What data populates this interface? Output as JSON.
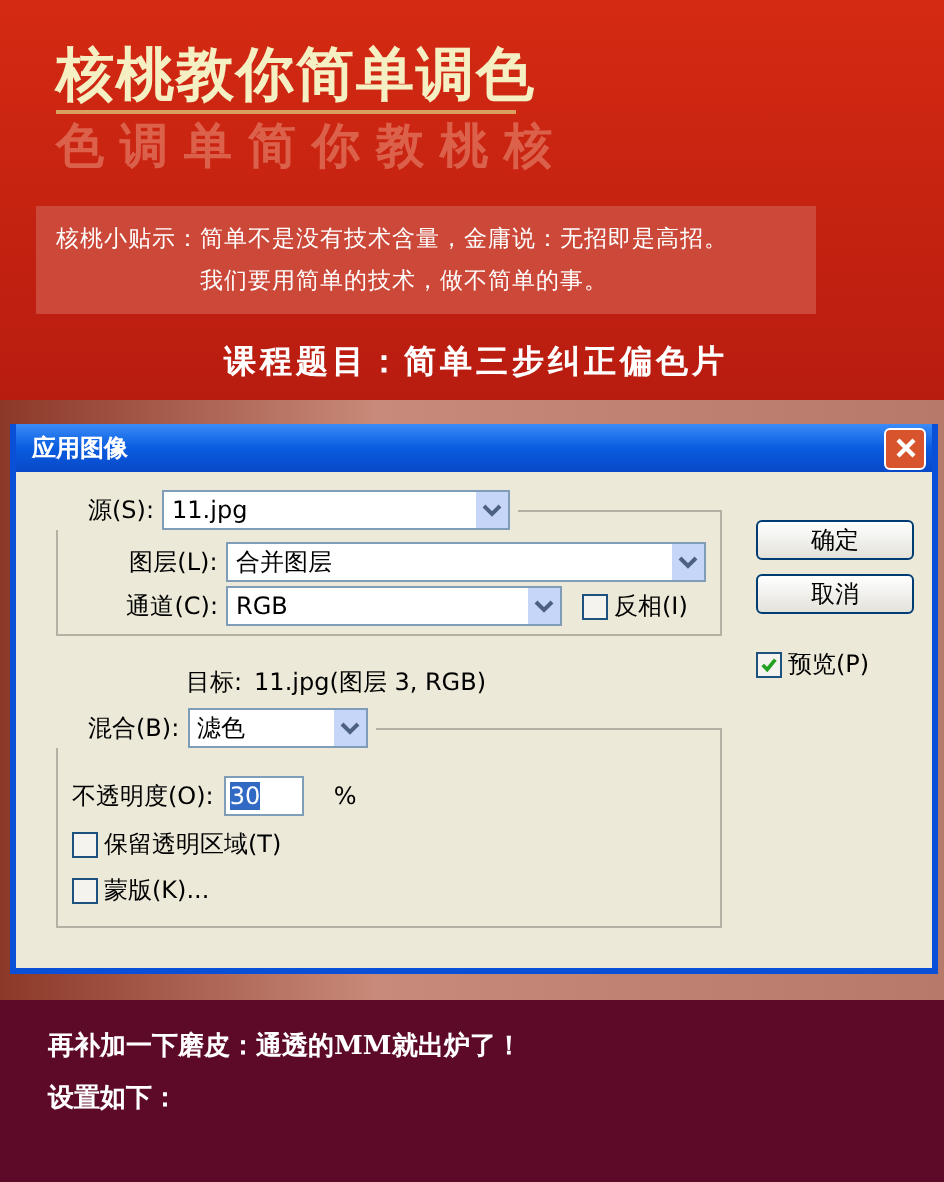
{
  "header": {
    "title": "核桃教你简单调色",
    "title_reflection": "色调单简你教桃核",
    "tip_label": "核桃小贴示：",
    "tip_lines": [
      "简单不是没有技术含量，金庸说：无招即是高招。",
      "我们要用简单的技术，做不简单的事。"
    ],
    "course": "课程题目：简单三步纠正偏色片"
  },
  "dialog": {
    "title": "应用图像",
    "source": {
      "label": "源(S):",
      "value": "11.jpg"
    },
    "layer": {
      "label": "图层(L):",
      "value": "合并图层"
    },
    "channel": {
      "label": "通道(C):",
      "value": "RGB"
    },
    "invert": {
      "label": "反相(I)",
      "checked": false
    },
    "buttons": [
      "确定",
      "取消"
    ],
    "preview": {
      "label": "预览(P)",
      "checked": true
    },
    "target": {
      "label": "目标:",
      "value": "11.jpg(图层 3, RGB)"
    },
    "blending": {
      "label": "混合(B):",
      "value": "滤色"
    },
    "opacity": {
      "label": "不透明度(O):",
      "value": "30",
      "unit": "%"
    },
    "options": [
      {
        "label": "保留透明区域(T)",
        "checked": false
      },
      {
        "label": "蒙版(K)...",
        "checked": false
      }
    ]
  },
  "footer": {
    "lines": [
      "再补加一下磨皮：通透的MM就出炉了！",
      "设置如下："
    ]
  }
}
